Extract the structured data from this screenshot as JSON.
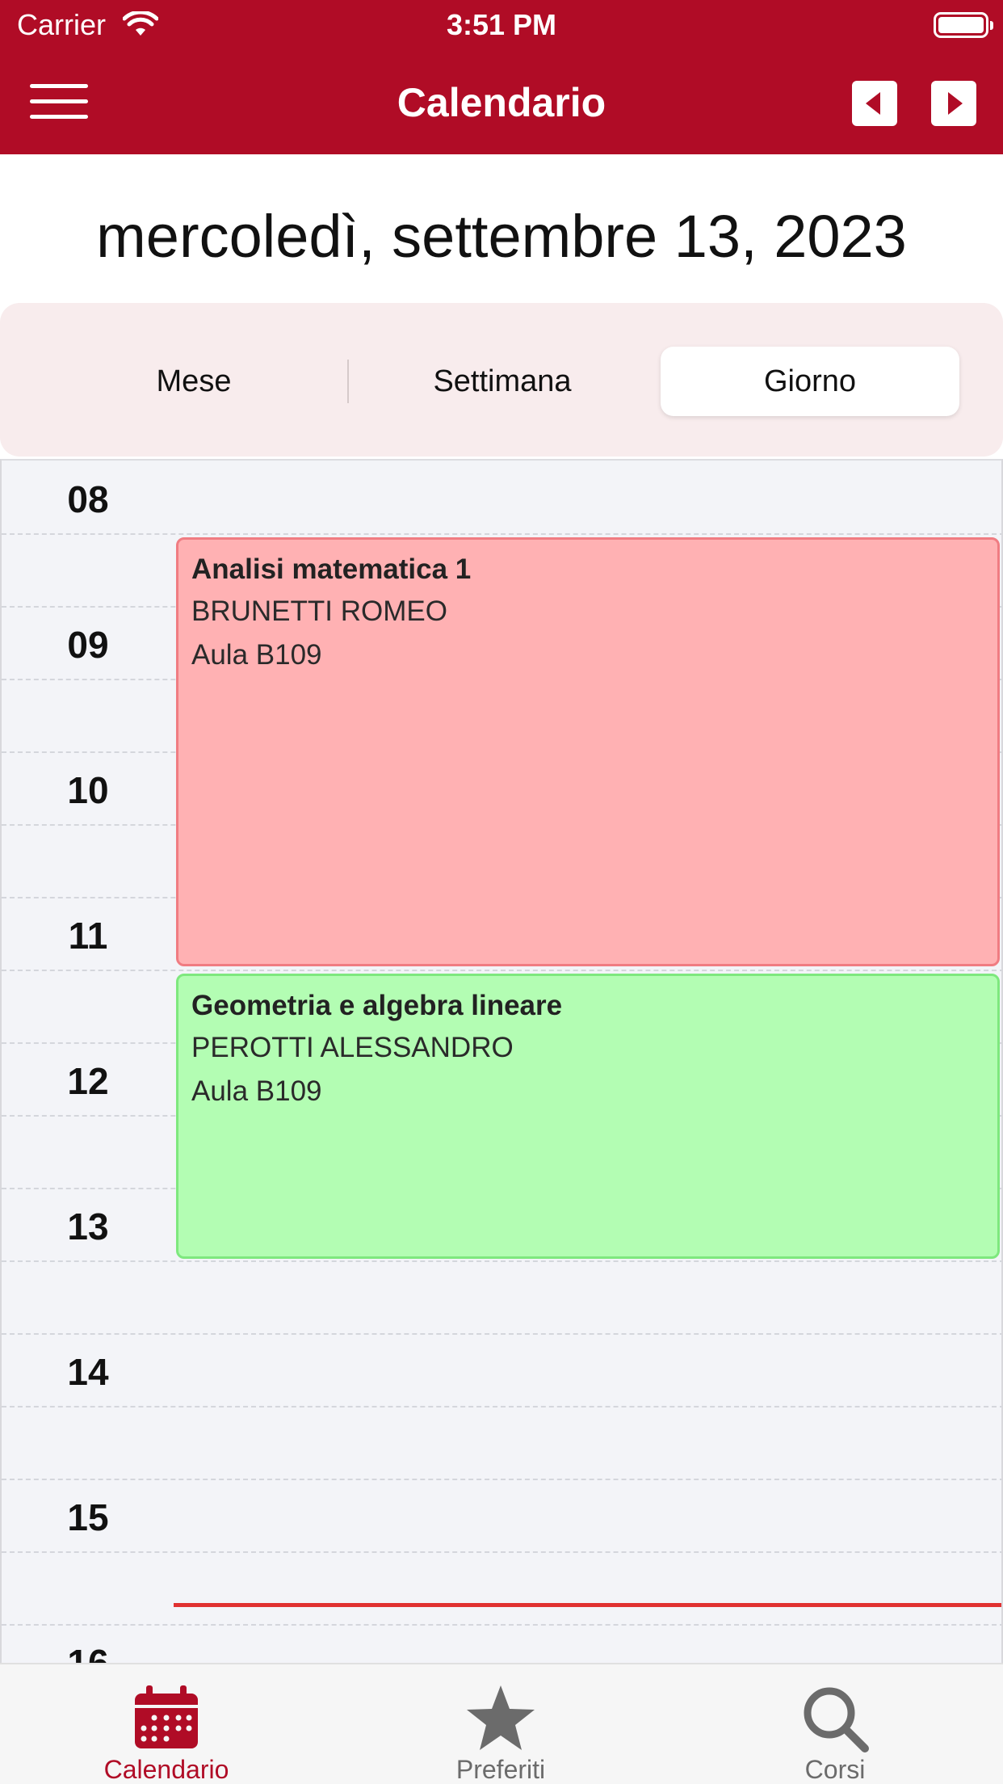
{
  "status_bar": {
    "carrier": "Carrier",
    "time": "3:51 PM"
  },
  "header": {
    "title": "Calendario",
    "brand_color": "#b00c26",
    "icons": [
      "menu-icon",
      "caret-left-icon",
      "caret-right-icon"
    ]
  },
  "date_title": "mercoledì, settembre 13, 2023",
  "view_switcher": {
    "options": [
      "Mese",
      "Settimana",
      "Giorno"
    ],
    "selected": "Giorno"
  },
  "timeline": {
    "hours": [
      "08",
      "09",
      "10",
      "11",
      "12",
      "13",
      "14",
      "15",
      "16"
    ],
    "events": [
      {
        "title": "Analisi matematica 1",
        "teacher": "BRUNETTI ROMEO",
        "room": "Aula B109",
        "color": "#ffb1b3"
      },
      {
        "title": "Geometria e algebra lineare",
        "teacher": "PEROTTI ALESSANDRO",
        "room": "Aula B109",
        "color": "#b3fdb3"
      }
    ],
    "now_indicator_color": "#e03131"
  },
  "tabbar": {
    "tabs": [
      {
        "label": "Calendario",
        "icon": "calendar-icon",
        "active": true
      },
      {
        "label": "Preferiti",
        "icon": "star-icon",
        "active": false
      },
      {
        "label": "Corsi",
        "icon": "search-icon",
        "active": false
      }
    ]
  }
}
